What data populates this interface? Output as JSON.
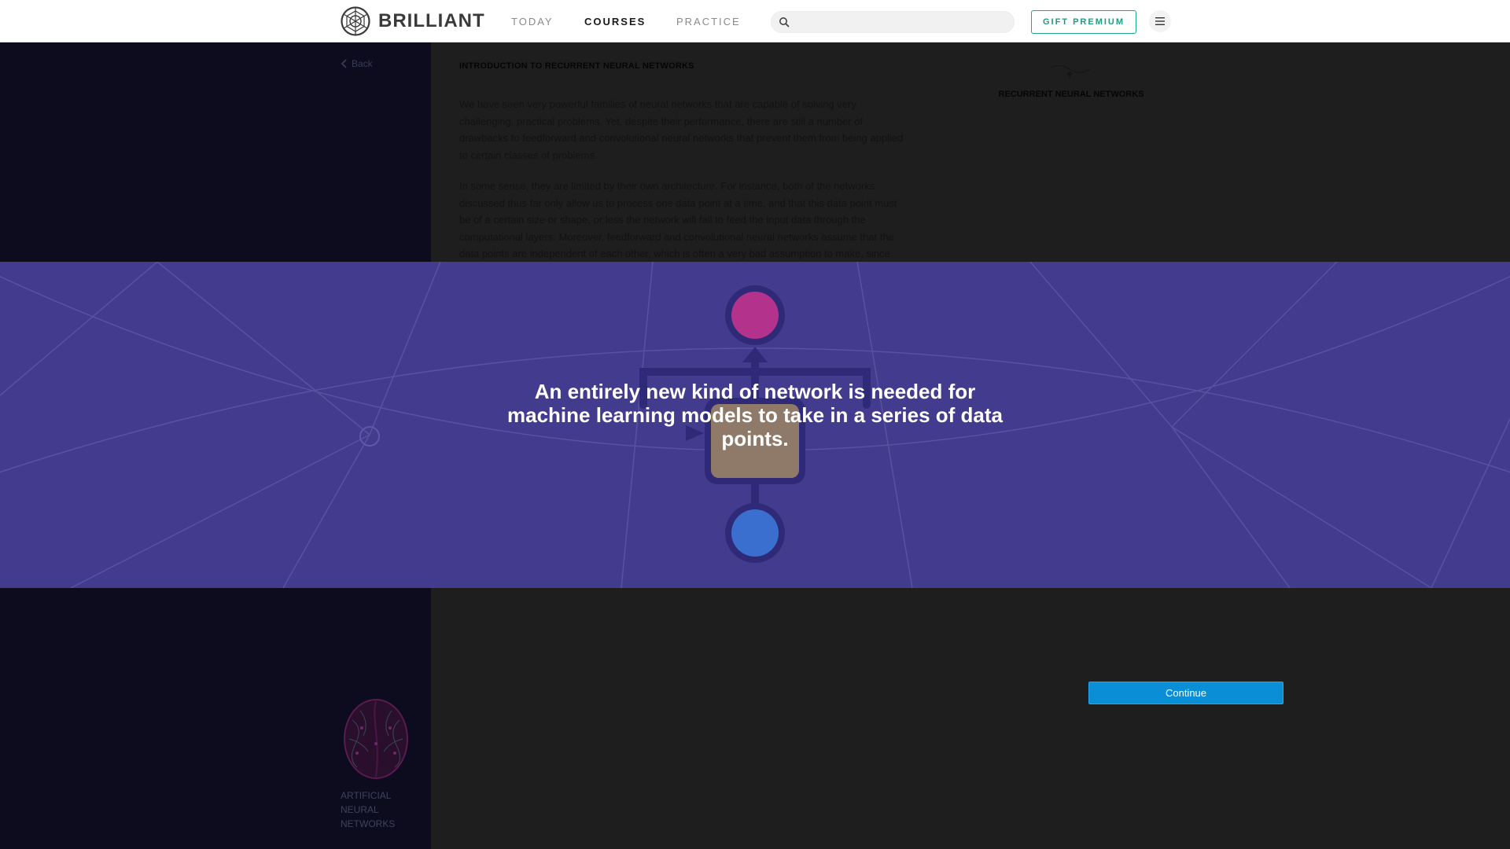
{
  "brand": {
    "name": "BRILLIANT"
  },
  "nav": {
    "today": "TODAY",
    "courses": "COURSES",
    "practice": "PRACTICE"
  },
  "search": {
    "placeholder": ""
  },
  "header": {
    "gift_label": "GIFT PREMIUM"
  },
  "sidebar": {
    "back_label": "Back",
    "course_title": "ARTIFICIAL NEURAL NETWORKS"
  },
  "content": {
    "chapter_title": "INTRODUCTION TO RECURRENT NEURAL NETWORKS",
    "paragraph_1": "We have seen very powerful families of neural networks that are capable of solving very challenging, practical problems. Yet, despite their performance, there are still a number of drawbacks to feedforward and convolutional neural networks that prevent them from being applied to certain classes of problems.",
    "paragraph_2": "In some sense, they are limited by their own architecture. For instance, both of the networks discussed thus far only allow us to process one data point at a time, and that this data point must be of a certain size or shape, or less the network will fail to feed the input data through the computational layers. Moreover, feedforward and convolutional neural networks assume that the data points are independent of each other, which is often a very bad assumption to make, since",
    "right_label": "RECURRENT NEURAL NETWORKS"
  },
  "interstitial": {
    "message": "An entirely new kind of network is needed for machine learning models to take in a series of data points.",
    "background": "#423b8e",
    "top_node_color": "#b3338c",
    "bottom_node_color": "#3a6fd0"
  },
  "actions": {
    "continue_label": "Continue"
  },
  "colors": {
    "accent": "#20a88a",
    "primary_button": "#0a8ed6",
    "sidebar": "#0c0c1e"
  }
}
